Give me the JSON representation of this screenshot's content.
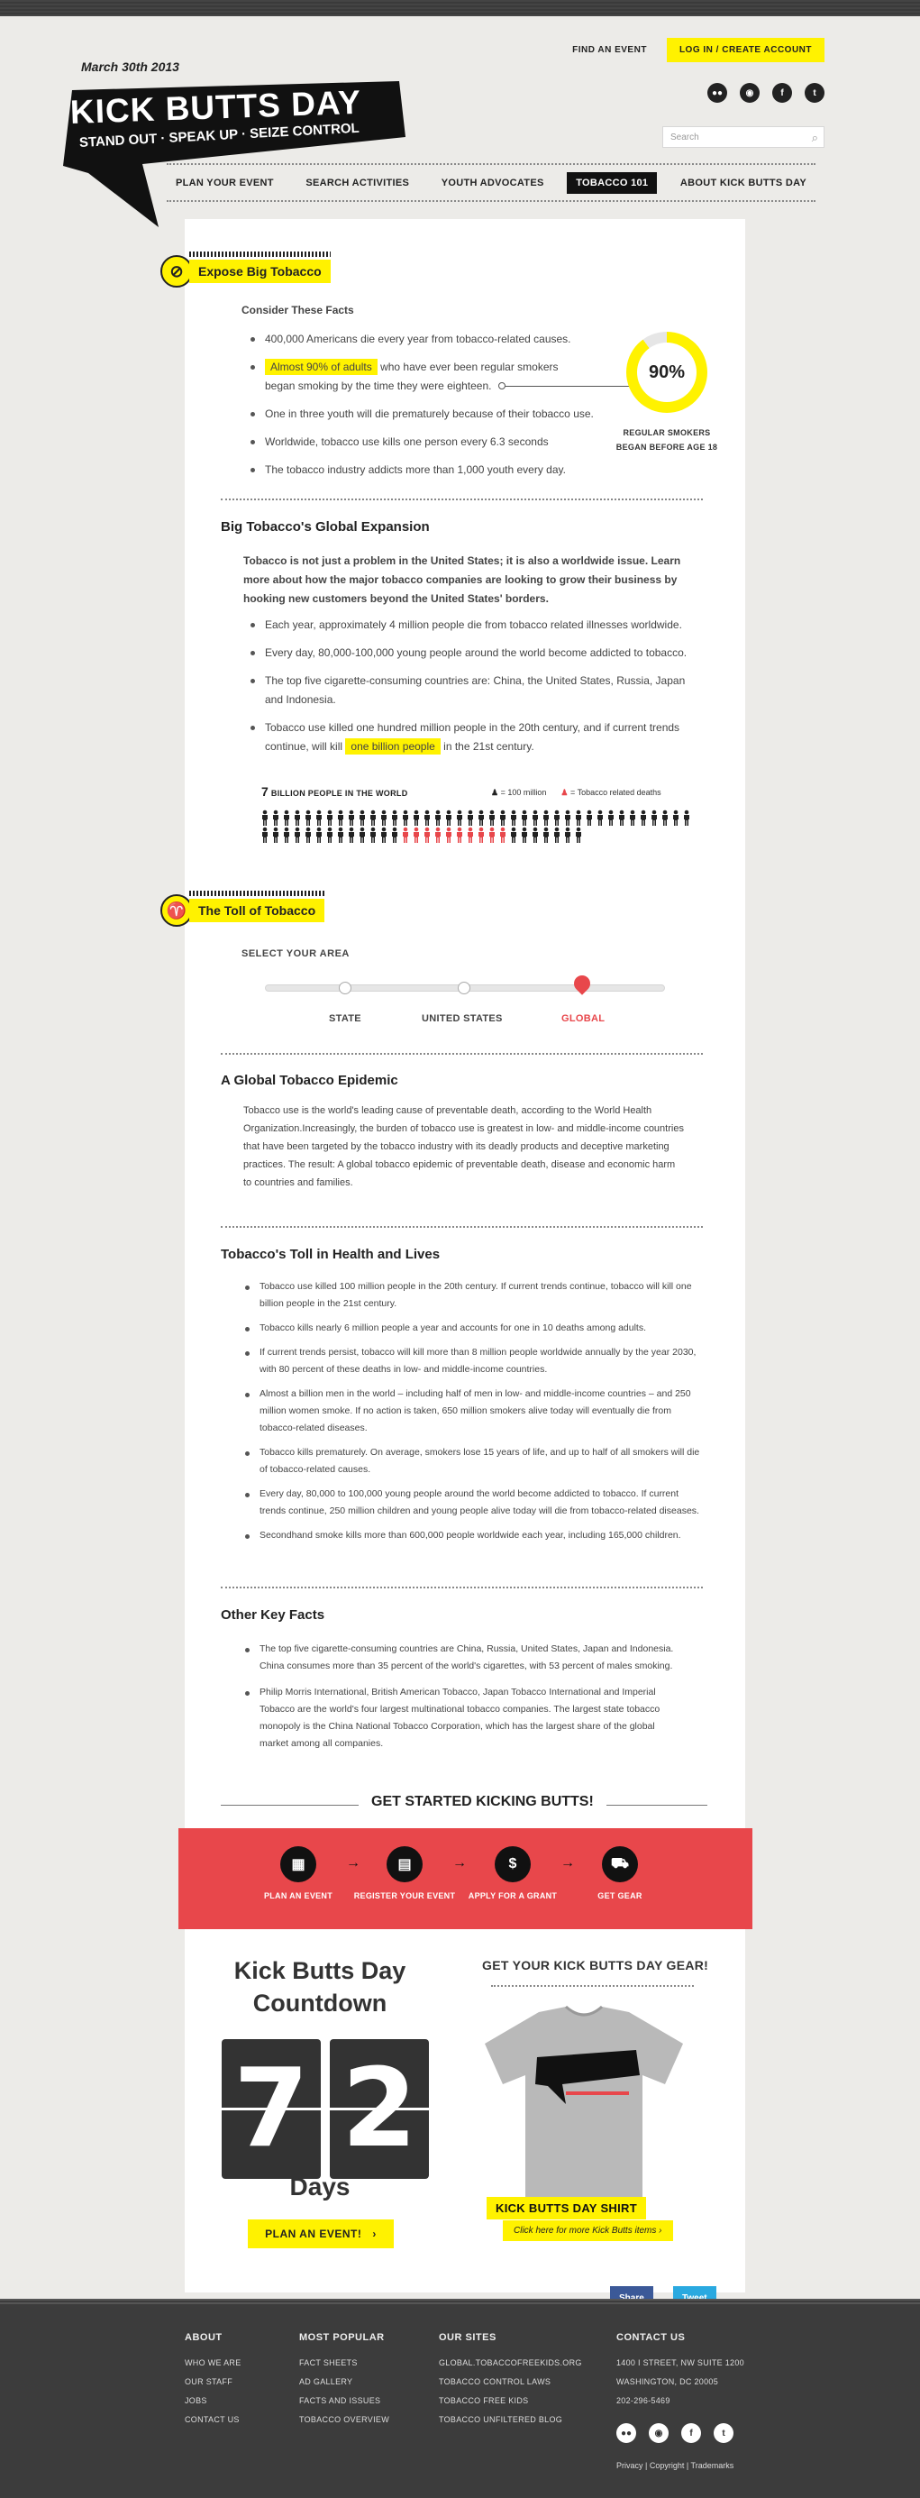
{
  "header": {
    "logo": {
      "date": "March 30th 2013",
      "title": "KICK BUTTS DAY",
      "tagline": "STAND OUT · SPEAK UP · SEIZE CONTROL"
    },
    "find_event": "FIND AN EVENT",
    "login": "LOG IN / CREATE ACCOUNT",
    "social": [
      "flickr-icon",
      "rss-icon",
      "facebook-icon",
      "twitter-icon"
    ],
    "search_placeholder": "Search",
    "nav": [
      "PLAN YOUR EVENT",
      "SEARCH ACTIVITIES",
      "YOUTH ADVOCATES",
      "TOBACCO 101",
      "ABOUT KICK BUTTS DAY"
    ],
    "nav_active": "TOBACCO 101"
  },
  "expose": {
    "heading": "Expose Big Tobacco",
    "subheading": "Consider These Facts",
    "fact1": "400,000 Americans die every year from tobacco-related causes.",
    "fact2_highlight": "Almost 90% of adults",
    "fact2_rest_a": "who have ever been regular smokers",
    "fact2_rest_b": "began smoking by the time they were eighteen.",
    "fact3": "One in three youth will die prematurely because of their tobacco use.",
    "fact4": "Worldwide, tobacco use kills one person every 6.3 seconds",
    "fact5": "The tobacco industry addicts more than 1,000 youth every day.",
    "donut_value": "90%",
    "donut_fraction": 0.9,
    "donut_caption_1": "REGULAR SMOKERS",
    "donut_caption_2": "BEGAN BEFORE AGE 18"
  },
  "global_expansion": {
    "heading": "Big Tobacco's Global Expansion",
    "intro": "Tobacco is not just a problem in the United States; it is also a worldwide issue. Learn more about how the major tobacco companies are  looking to grow their business by hooking new customers beyond the United States' borders.",
    "item1": "Each year, approximately 4 million people die from tobacco related illnesses worldwide.",
    "item2": "Every day, 80,000-100,000 young people around the world become addicted to tobacco.",
    "item3": "The top five cigarette-consuming countries are: China, the United States, Russia, Japan and Indonesia.",
    "item4_a": "Tobacco use killed one hundred million people in the 20th century, and if current trends continue, will kill",
    "item4_highlight": "one billion people",
    "item4_b": "in the 21st century.",
    "infographic_number": "7",
    "infographic_title": "BILLION PEOPLE IN THE WORLD",
    "legend_person": "= 100 million",
    "legend_red": "= Tobacco related deaths",
    "person_total": 70,
    "person_red": 10
  },
  "toll": {
    "heading": "The Toll of Tobacco",
    "select_area": "SELECT YOUR AREA",
    "areas": [
      "STATE",
      "UNITED STATES",
      "GLOBAL"
    ],
    "selected_area": "GLOBAL"
  },
  "epidemic": {
    "heading": "A Global Tobacco Epidemic",
    "text": "Tobacco use is the world's leading cause of preventable death, according to the World Health Organization.Increasingly, the burden of tobacco use is greatest in low- and middle-income countries that have been targeted by the tobacco industry with its deadly products and deceptive marketing practices. The result: A global tobacco epidemic of preventable death, disease and economic harm to countries and families."
  },
  "health_toll": {
    "heading": "Tobacco's Toll in Health and Lives",
    "items": [
      "Tobacco use killed 100 million people in the 20th century. If current trends continue, tobacco will kill one billion people in the 21st century.",
      "Tobacco kills nearly 6 million people a year and accounts for one in 10 deaths among adults.",
      "If current trends persist, tobacco will kill more than 8 million people worldwide annually by the year 2030, with 80 percent of these deaths in low- and middle-income countries.",
      "Almost a billion men in the world – including half of men in low- and middle-income countries – and 250 million women smoke. If no action is taken, 650 million smokers alive today will eventually die from tobacco-related diseases.",
      "Tobacco kills prematurely. On average, smokers lose 15 years of life, and up to half of all smokers will die of tobacco-related causes.",
      "Every day, 80,000 to 100,000 young people around the world become addicted to tobacco. If current trends continue, 250 million children and young people alive today will die from tobacco-related diseases.",
      "Secondhand smoke kills more than 600,000 people worldwide each year, including 165,000 children."
    ]
  },
  "other_facts": {
    "heading": "Other Key Facts",
    "items": [
      "The top five cigarette-consuming countries are China, Russia, United States, Japan and Indonesia. China consumes more than 35 percent of the world's cigarettes, with 53 percent of males smoking.",
      "Philip Morris International, British American Tobacco, Japan Tobacco International and Imperial Tobacco are the world's four largest multinational tobacco companies. The largest state tobacco monopoly is the China National Tobacco Corporation, which has the largest share of the global market among all companies."
    ]
  },
  "cta": {
    "title": "GET STARTED KICKING BUTTS!",
    "steps": [
      "PLAN AN EVENT",
      "REGISTER YOUR EVENT",
      "APPLY FOR A GRANT",
      "GET GEAR"
    ],
    "step_icons": [
      "calendar-icon",
      "clipboard-icon",
      "dollar-icon",
      "cart-icon"
    ]
  },
  "countdown": {
    "title_1": "Kick Butts Day",
    "title_2": "Countdown",
    "digit1": "7",
    "digit2": "2",
    "unit": "Days",
    "button": "PLAN AN EVENT!"
  },
  "gear": {
    "title": "GET YOUR KICK BUTTS DAY GEAR!",
    "shirt_label": "KICK BUTTS DAY SHIRT",
    "shirt_link": "Click here for more Kick Butts items"
  },
  "share": {
    "facebook": "Share",
    "twitter": "Tweet"
  },
  "footer": {
    "about_title": "ABOUT",
    "about_links": [
      "WHO WE ARE",
      "OUR STAFF",
      "JOBS",
      "CONTACT US"
    ],
    "popular_title": "MOST POPULAR",
    "popular_links": [
      "FACT SHEETS",
      "AD GALLERY",
      "FACTS AND ISSUES",
      "TOBACCO OVERVIEW"
    ],
    "sites_title": "OUR SITES",
    "sites_links": [
      "GLOBAL.TOBACCOFREEKIDS.ORG",
      "TOBACCO CONTROL LAWS",
      "TOBACCO FREE KIDS",
      "TOBACCO UNFILTERED BLOG"
    ],
    "contact_title": "CONTACT US",
    "address_1": "1400 I STREET, NW SUITE 1200",
    "address_2": "WASHINGTON, DC 20005",
    "phone": "202-296-5469",
    "legal": "Privacy | Copyright | Trademarks"
  },
  "colors": {
    "accent": "#fff200",
    "red": "#e8474b",
    "dark": "#222222",
    "footer": "#3c3c3c"
  }
}
